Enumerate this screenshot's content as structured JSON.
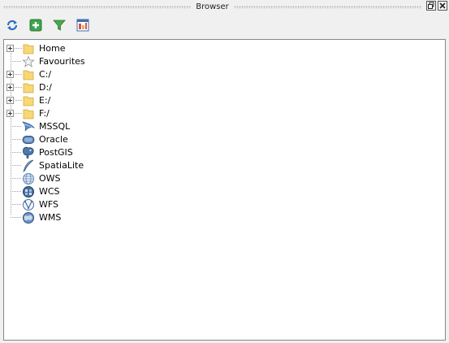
{
  "window": {
    "title": "Browser",
    "float_button_icon": "restore-icon",
    "close_button_icon": "close-icon"
  },
  "toolbar": {
    "buttons": [
      {
        "icon": "refresh-icon"
      },
      {
        "icon": "add-icon"
      },
      {
        "icon": "filter-icon"
      },
      {
        "icon": "properties-icon"
      }
    ]
  },
  "tree": {
    "items": [
      {
        "label": "Home",
        "icon": "folder-icon",
        "expandable": true
      },
      {
        "label": "Favourites",
        "icon": "star-icon",
        "expandable": false
      },
      {
        "label": "C:/",
        "icon": "folder-icon",
        "expandable": true
      },
      {
        "label": "D:/",
        "icon": "folder-icon",
        "expandable": true
      },
      {
        "label": "E:/",
        "icon": "folder-icon",
        "expandable": true
      },
      {
        "label": "F:/",
        "icon": "folder-icon",
        "expandable": true
      },
      {
        "label": "MSSQL",
        "icon": "mssql-icon",
        "expandable": false
      },
      {
        "label": "Oracle",
        "icon": "oracle-icon",
        "expandable": false
      },
      {
        "label": "PostGIS",
        "icon": "postgis-icon",
        "expandable": false
      },
      {
        "label": "SpatiaLite",
        "icon": "spatialite-icon",
        "expandable": false
      },
      {
        "label": "OWS",
        "icon": "ows-icon",
        "expandable": false
      },
      {
        "label": "WCS",
        "icon": "wcs-icon",
        "expandable": false
      },
      {
        "label": "WFS",
        "icon": "wfs-icon",
        "expandable": false
      },
      {
        "label": "WMS",
        "icon": "wms-icon",
        "expandable": false
      }
    ]
  },
  "colors": {
    "panel_background": "#f0f0f0",
    "tree_background": "#ffffff",
    "folder": "#f8d775",
    "accent_blue": "#3a6ea5"
  }
}
